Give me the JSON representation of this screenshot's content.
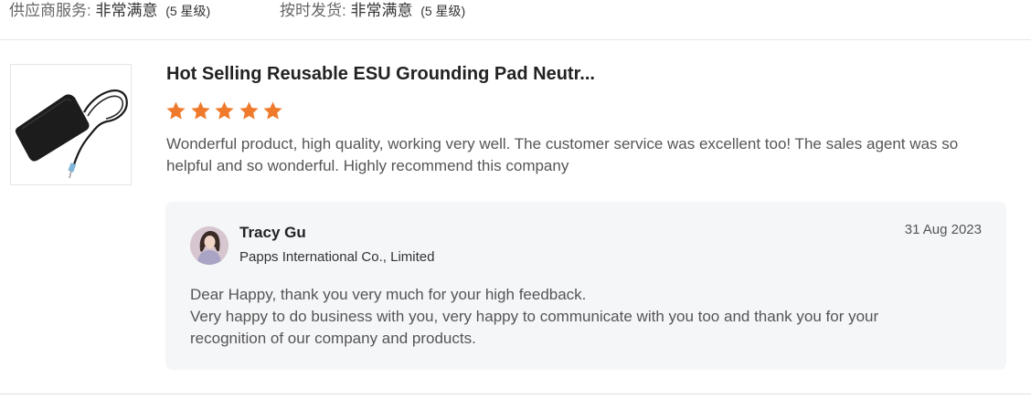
{
  "ratings": [
    {
      "label": "供应商服务:",
      "value": "非常满意",
      "stars_text": "(5 星级)"
    },
    {
      "label": "按时发货:",
      "value": "非常满意",
      "stars_text": "(5 星级)"
    }
  ],
  "review": {
    "product_title": "Hot Selling Reusable ESU Grounding Pad Neutr...",
    "rating": 5,
    "rating_max": 5,
    "text": "Wonderful product, high quality, working very well. The customer service was excellent too! The sales agent was so helpful and so wonderful. Highly recommend this company"
  },
  "reply": {
    "name": "Tracy Gu",
    "company": "Papps International Co., Limited",
    "date": "31 Aug 2023",
    "lines": [
      "Dear Happy, thank you very much for your high feedback.",
      "Very happy to do business with you, very happy to communicate with you too and thank you for your recognition of our company and products."
    ]
  },
  "icons": {
    "star": "star-icon",
    "product_image": "grounding-pad-image",
    "avatar": "avatar-image"
  },
  "colors": {
    "star": "#f07a2b",
    "card_bg": "#f5f6f8"
  }
}
